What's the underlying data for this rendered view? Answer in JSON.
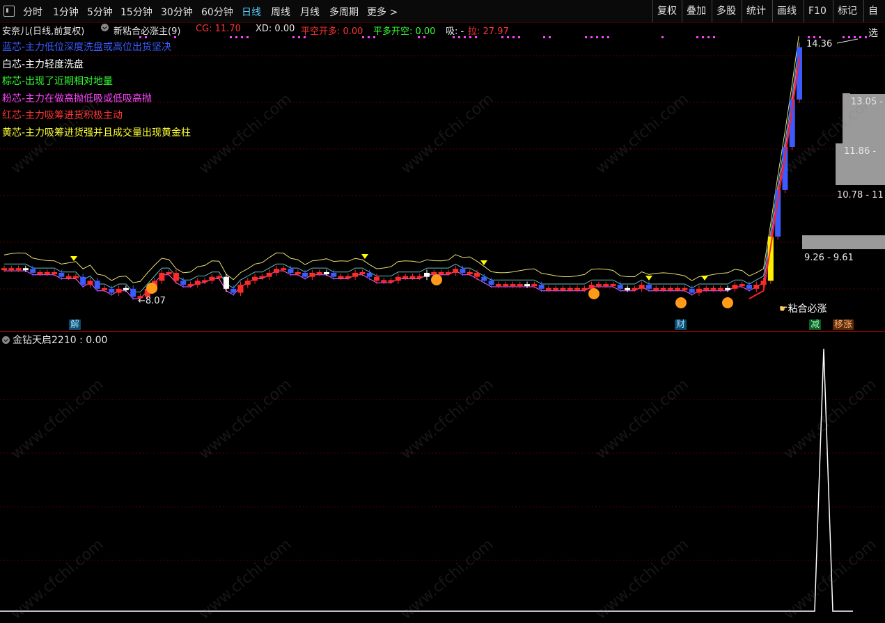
{
  "toolbar": {
    "periods": [
      "分时",
      "1分钟",
      "5分钟",
      "15分钟",
      "30分钟",
      "60分钟",
      "日线",
      "周线",
      "月线",
      "多周期",
      "更多 >"
    ],
    "active_period": "日线",
    "right_items": [
      "复权",
      "叠加",
      "多股",
      "统计",
      "画线",
      "F10",
      "标记",
      "自选"
    ]
  },
  "info": {
    "stock": "安奈儿(日线,前复权)",
    "indicator": "新粘合必涨主(9)",
    "cg": "CG: 11.70",
    "xd": "XD: 0.00",
    "pkkd": "平空开多: 0.00",
    "pdkk": "平多开空: 0.00",
    "xi": "吸: -",
    "la": "拉: 27.97"
  },
  "legend_lines": [
    {
      "text": "蓝芯-主力低位深度洗盘或高位出货坚决",
      "color": "#3a5bff"
    },
    {
      "text": "白芯-主力轻度洗盘",
      "color": "#ffffff"
    },
    {
      "text": "棕芯-出现了近期相对地量",
      "color": "#33ff33"
    },
    {
      "text": "粉芯-主力在做高抛低吸或低吸高抛",
      "color": "#ff44ff"
    },
    {
      "text": "红芯-主力吸筹进货积极主动",
      "color": "#ff3333"
    },
    {
      "text": "黄芯-主力吸筹进货强并且成交量出现黄金柱",
      "color": "#ffff33"
    }
  ],
  "annotations": {
    "low_label": "←8.07",
    "high_label": "14.36",
    "box1": "13.05 -",
    "box2": "11.86 -",
    "box3": "10.78 - 11",
    "box4": "9.26 - 9.61",
    "signal_text": "粘合必涨",
    "marker_jie": "解",
    "marker_cai": "财",
    "marker_jian": "减",
    "marker_yizhang": "移涨"
  },
  "sub_panel": {
    "title": "金钻天启2210 : 0.00"
  },
  "watermark": "www.cfchi.com",
  "chart_data": [
    {
      "type": "line",
      "title": "",
      "note": "daily candlestick main chart; close prices approximated",
      "series": [
        {
          "name": "close",
          "values": [
            8.8,
            8.8,
            8.8,
            8.8,
            8.7,
            8.7,
            8.7,
            8.7,
            8.6,
            8.6,
            8.6,
            8.4,
            8.5,
            8.3,
            8.3,
            8.2,
            8.3,
            8.3,
            8.1,
            8.1,
            8.3,
            8.5,
            8.7,
            8.7,
            8.5,
            8.4,
            8.4,
            8.5,
            8.5,
            8.6,
            8.6,
            8.3,
            8.2,
            8.4,
            8.5,
            8.6,
            8.6,
            8.7,
            8.8,
            8.8,
            8.7,
            8.7,
            8.6,
            8.7,
            8.7,
            8.7,
            8.6,
            8.6,
            8.6,
            8.7,
            8.7,
            8.6,
            8.5,
            8.5,
            8.5,
            8.6,
            8.6,
            8.6,
            8.6,
            8.7,
            8.7,
            8.7,
            8.7,
            8.8,
            8.7,
            8.7,
            8.6,
            8.5,
            8.4,
            8.4,
            8.4,
            8.4,
            8.4,
            8.4,
            8.4,
            8.3,
            8.3,
            8.3,
            8.3,
            8.3,
            8.3,
            8.3,
            8.4,
            8.4,
            8.4,
            8.4,
            8.3,
            8.3,
            8.3,
            8.4,
            8.3,
            8.3,
            8.3,
            8.3,
            8.3,
            8.3,
            8.2,
            8.3,
            8.3,
            8.3,
            8.3,
            8.3,
            8.4,
            8.4,
            8.3,
            8.4,
            8.5,
            9.61,
            10.78,
            11.86,
            13.05,
            14.36
          ]
        },
        {
          "name": "ma_red",
          "values": []
        }
      ],
      "ylim": [
        8.0,
        14.5
      ]
    },
    {
      "type": "line",
      "title": "金钻天启2210",
      "series": [
        {
          "name": "金钻天启2210",
          "values": [
            0,
            0,
            0,
            0,
            0,
            0,
            0,
            0,
            0,
            0,
            1,
            0,
            0
          ]
        }
      ],
      "ylim": [
        0,
        1
      ]
    }
  ]
}
